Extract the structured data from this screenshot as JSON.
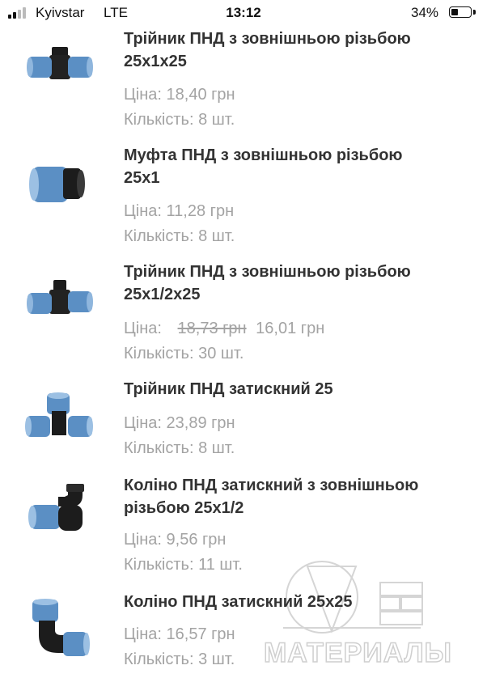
{
  "status_bar": {
    "carrier": "Kyivstar",
    "network": "LTE",
    "time": "13:12",
    "battery": "34%"
  },
  "products": [
    {
      "title_line1": "Трійник ПНД з зовнішньою різьбою",
      "title_line2": "25x1x25",
      "price_label": "Ціна:",
      "price": "18,40 грн",
      "qty": "Кількість: 8 шт.",
      "icon": "tee-threaded-icon"
    },
    {
      "title_line1": "Муфта ПНД з зовнішньою різьбою",
      "title_line2": "25x1",
      "price_label": "Ціна:",
      "price": "11,28 грн",
      "qty": "Кількість: 8 шт.",
      "icon": "coupling-threaded-icon"
    },
    {
      "title_line1": "Трійник ПНД з зовнішньою різьбою",
      "title_line2": "25x1/2x25",
      "price_label": "Ціна:",
      "old_price": "18,73 грн",
      "price": "16,01 грн",
      "qty": "Кількість: 30 шт.",
      "icon": "tee-threaded-icon"
    },
    {
      "title_line1": "Трійник ПНД затискний 25",
      "price_label": "Ціна:",
      "price": "23,89 грн",
      "qty": "Кількість: 8 шт.",
      "icon": "tee-compression-icon"
    },
    {
      "title_line1": "Коліно ПНД затискний з зовнішньою",
      "title_line2": "різьбою 25x1/2",
      "price_label": "Ціна:",
      "price": "9,56 грн",
      "qty": "Кількість: 11 шт.",
      "icon": "elbow-threaded-icon"
    },
    {
      "title_line1": "Коліно ПНД затискний 25x25",
      "price_label": "Ціна:",
      "price": "16,57 грн",
      "qty": "Кількість: 3 шт.",
      "icon": "elbow-compression-icon"
    }
  ],
  "watermark": {
    "text": "МАТЕРИАЛЫ"
  },
  "colors": {
    "title": "#333333",
    "muted": "#a3a3a3",
    "fitting_blue": "#5b8fc4",
    "fitting_dark": "#1c1c1c"
  }
}
